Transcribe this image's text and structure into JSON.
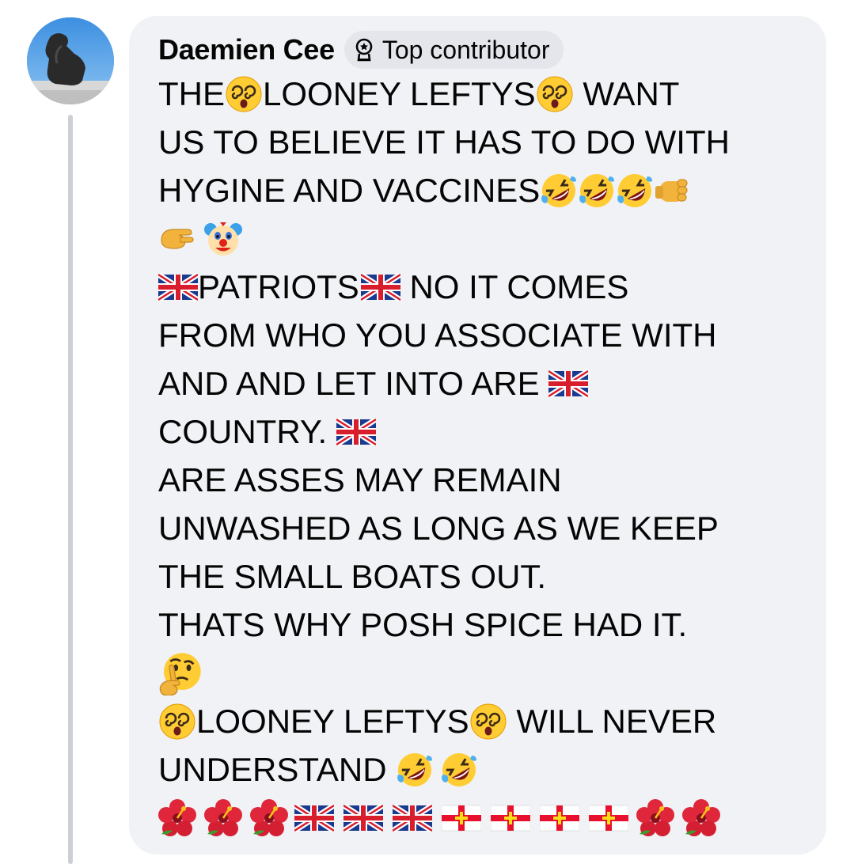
{
  "comment": {
    "author": "Daemien Cee",
    "badge": "Top contributor",
    "lines": {
      "l1a": "THE ",
      "l1b": "LOONEY LEFTYS",
      "l1c": " WANT",
      "l2": "US TO BELIEVE IT HAS TO DO WITH",
      "l3": "HYGINE AND VACCINES",
      "l5a": "PATRIOTS",
      "l5b": " NO IT COMES",
      "l6": "FROM WHO YOU ASSOCIATE WITH",
      "l7": "AND AND LET INTO ARE ",
      "l8": "COUNTRY. ",
      "l9": "ARE ASSES MAY REMAIN",
      "l10": "UNWASHED AS LONG AS WE KEEP",
      "l11": "THE SMALL BOATS OUT.",
      "l12": "THATS WHY POSH SPICE HAD IT.",
      "l14a": "LOONEY LEFTYS",
      "l14b": " WILL NEVER",
      "l15": "UNDERSTAND "
    }
  },
  "icons": {
    "dizzy": "dizzy-face-emoji",
    "laugh": "rolling-on-floor-laughing-emoji",
    "fist": "oncoming-fist-emoji",
    "pinch": "pinching-hand-emoji",
    "clown": "clown-face-emoji",
    "uk": "united-kingdom-flag",
    "think": "thinking-face-emoji",
    "hibiscus": "hibiscus-emoji",
    "guernsey": "guernsey-flag"
  },
  "colors": {
    "bubble": "#f0f2f5",
    "badge": "#e4e6eb",
    "text": "#050505",
    "thread_line": "#ccd0d5"
  }
}
